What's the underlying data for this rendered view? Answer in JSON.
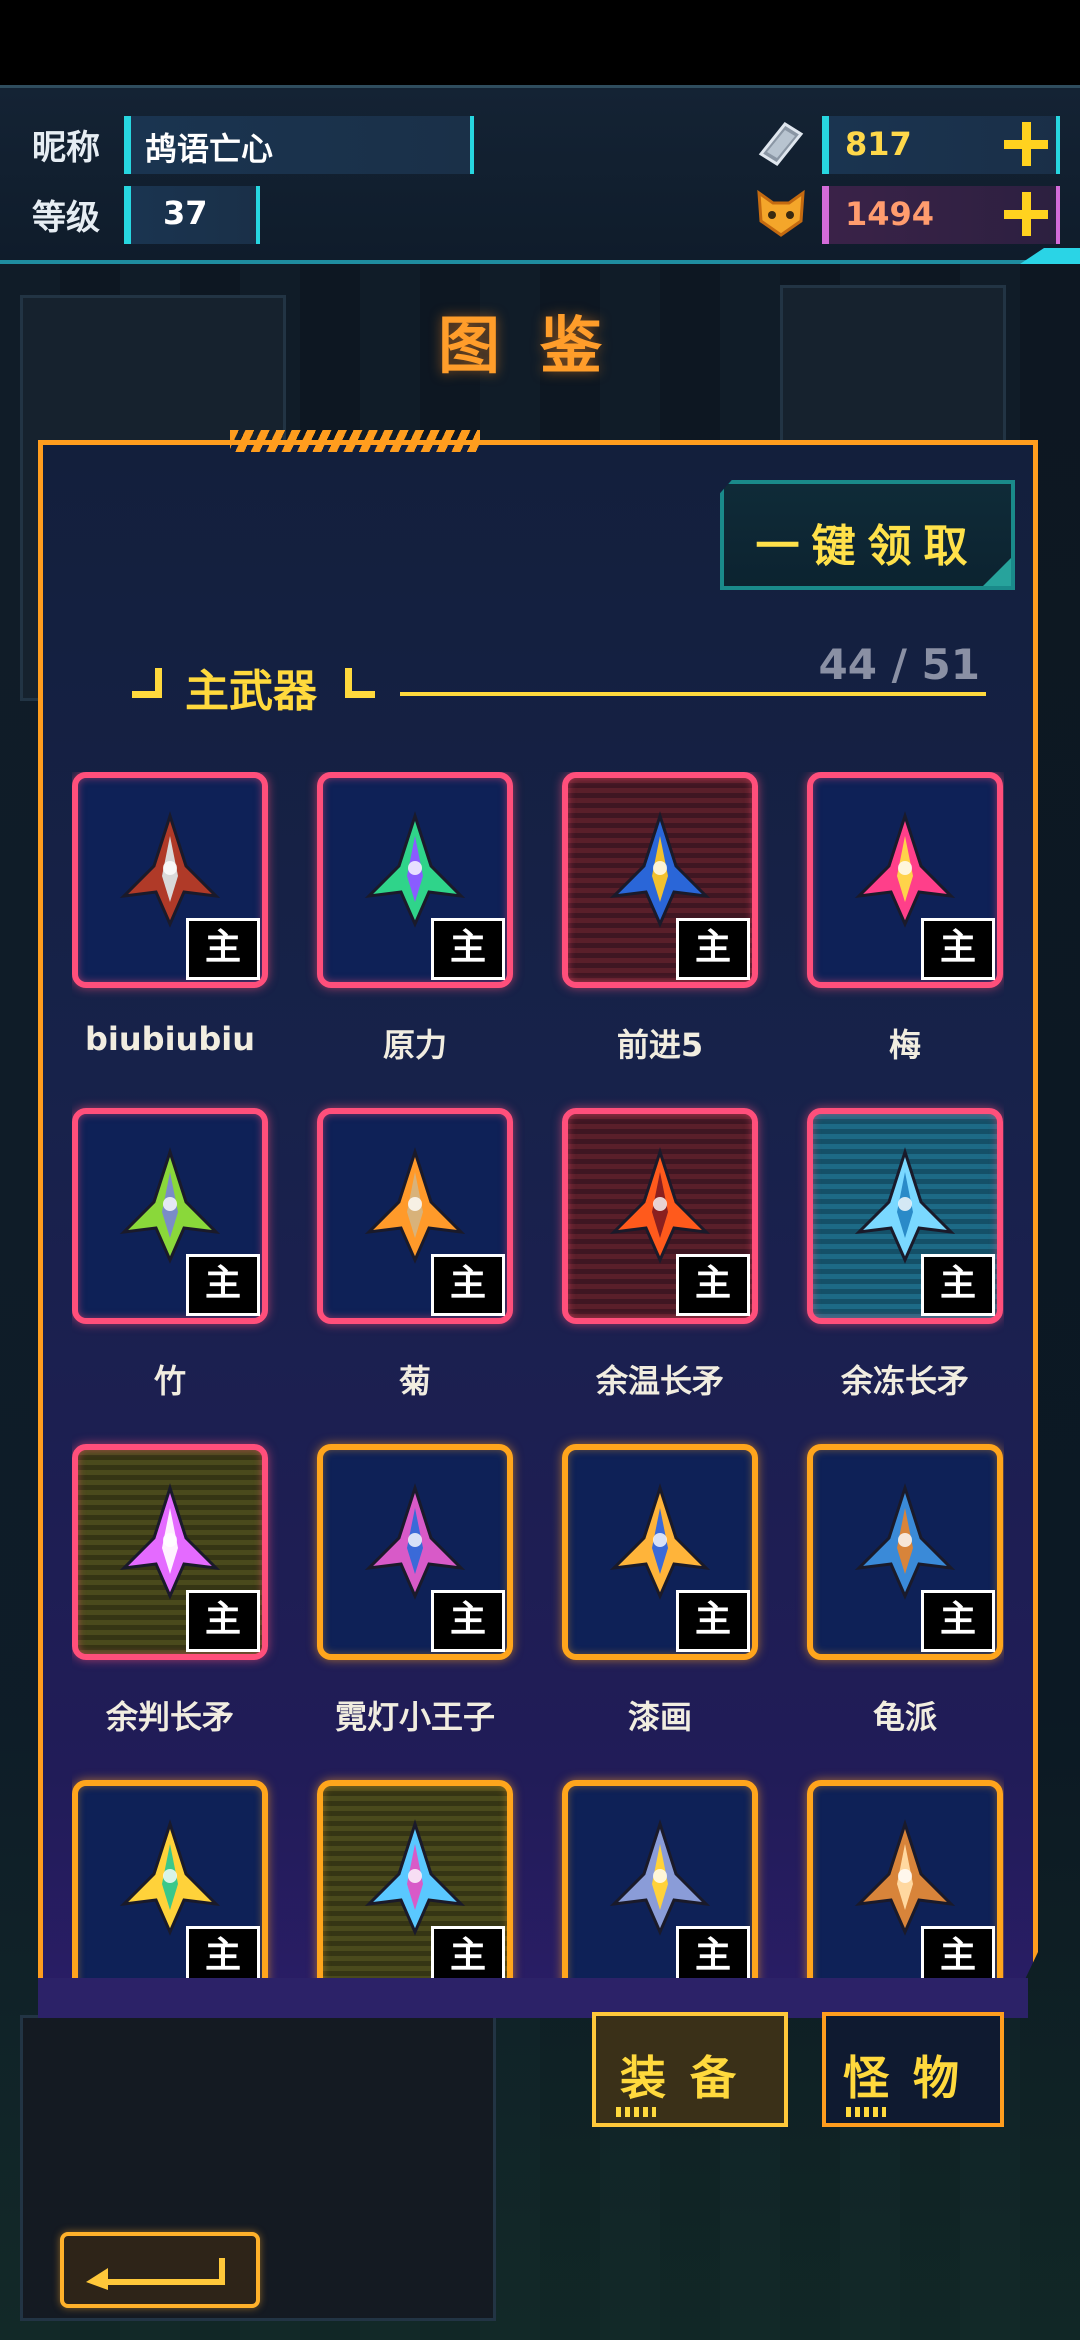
{
  "header": {
    "nickname_label": "昵称",
    "nickname_value": "鸪语亡心",
    "level_label": "等级",
    "level_value": "37",
    "currency_1": {
      "icon": "ticket-icon",
      "value": "817"
    },
    "currency_2": {
      "icon": "cat-face-icon",
      "value": "1494"
    }
  },
  "page_title": "图鉴",
  "claim_button": "一键领取",
  "section": {
    "title": "主武器",
    "count": "44 / 51"
  },
  "tag_label": "主",
  "items": [
    {
      "name": "biubiubiu",
      "frame": "pink",
      "bg": "blue",
      "icon": "biubiubiu-weapon-icon",
      "colors": [
        "#b03a28",
        "#d9d9d9"
      ]
    },
    {
      "name": "原力",
      "frame": "pink",
      "bg": "blue",
      "icon": "force-weapon-icon",
      "colors": [
        "#2fd48a",
        "#8a5cff"
      ]
    },
    {
      "name": "前进5",
      "frame": "pink",
      "bg": "red",
      "icon": "forward5-weapon-icon",
      "colors": [
        "#2a66d8",
        "#f2c12e"
      ]
    },
    {
      "name": "梅",
      "frame": "pink",
      "bg": "blue",
      "icon": "plum-weapon-icon",
      "colors": [
        "#ff3f8a",
        "#ffd34a"
      ]
    },
    {
      "name": "竹",
      "frame": "pink",
      "bg": "blue",
      "icon": "bamboo-weapon-icon",
      "colors": [
        "#8ad83a",
        "#7a8cc8"
      ]
    },
    {
      "name": "菊",
      "frame": "pink",
      "bg": "blue",
      "icon": "chrysanthemum-weapon-icon",
      "colors": [
        "#ff9a2a",
        "#d8b27a"
      ]
    },
    {
      "name": "余温长矛",
      "frame": "pink",
      "bg": "red",
      "icon": "warm-spear-icon",
      "colors": [
        "#ff5a1c",
        "#8a1f1f"
      ]
    },
    {
      "name": "余冻长矛",
      "frame": "pink",
      "bg": "cyan",
      "icon": "frozen-spear-icon",
      "colors": [
        "#7ad8ff",
        "#2a8ac8"
      ]
    },
    {
      "name": "余判长矛",
      "frame": "pink",
      "bg": "olive",
      "icon": "judge-spear-icon",
      "colors": [
        "#e46aff",
        "#fff2ff"
      ]
    },
    {
      "name": "霓灯小王子",
      "frame": "gold",
      "bg": "blue",
      "icon": "neon-prince-icon",
      "colors": [
        "#d85ac8",
        "#3a6ad8"
      ]
    },
    {
      "name": "漆画",
      "frame": "gold",
      "bg": "blue",
      "icon": "lacquer-painting-icon",
      "colors": [
        "#ffb43a",
        "#3a6ad8"
      ]
    },
    {
      "name": "龟派",
      "frame": "gold",
      "bg": "blue",
      "icon": "turtle-school-icon",
      "colors": [
        "#3a8ad8",
        "#d8843a"
      ]
    },
    {
      "name": "",
      "frame": "gold",
      "bg": "blue",
      "icon": "beetle-weapon-icon",
      "colors": [
        "#ffd23a",
        "#3ac88a"
      ]
    },
    {
      "name": "",
      "frame": "gold",
      "bg": "olive",
      "icon": "crescent-weapon-icon",
      "colors": [
        "#5ac8ff",
        "#d85ac8"
      ]
    },
    {
      "name": "",
      "frame": "gold",
      "bg": "blue",
      "icon": "twin-rockets-icon",
      "colors": [
        "#8a9cd8",
        "#ffd23a"
      ]
    },
    {
      "name": "",
      "frame": "gold",
      "bg": "blue",
      "icon": "lantern-weapon-icon",
      "colors": [
        "#d8843a",
        "#ffd8a0"
      ]
    }
  ],
  "tabs": [
    {
      "label": "装备",
      "active": true
    },
    {
      "label": "怪物",
      "active": false
    }
  ],
  "back_button": {
    "icon": "back-arrow-icon"
  }
}
